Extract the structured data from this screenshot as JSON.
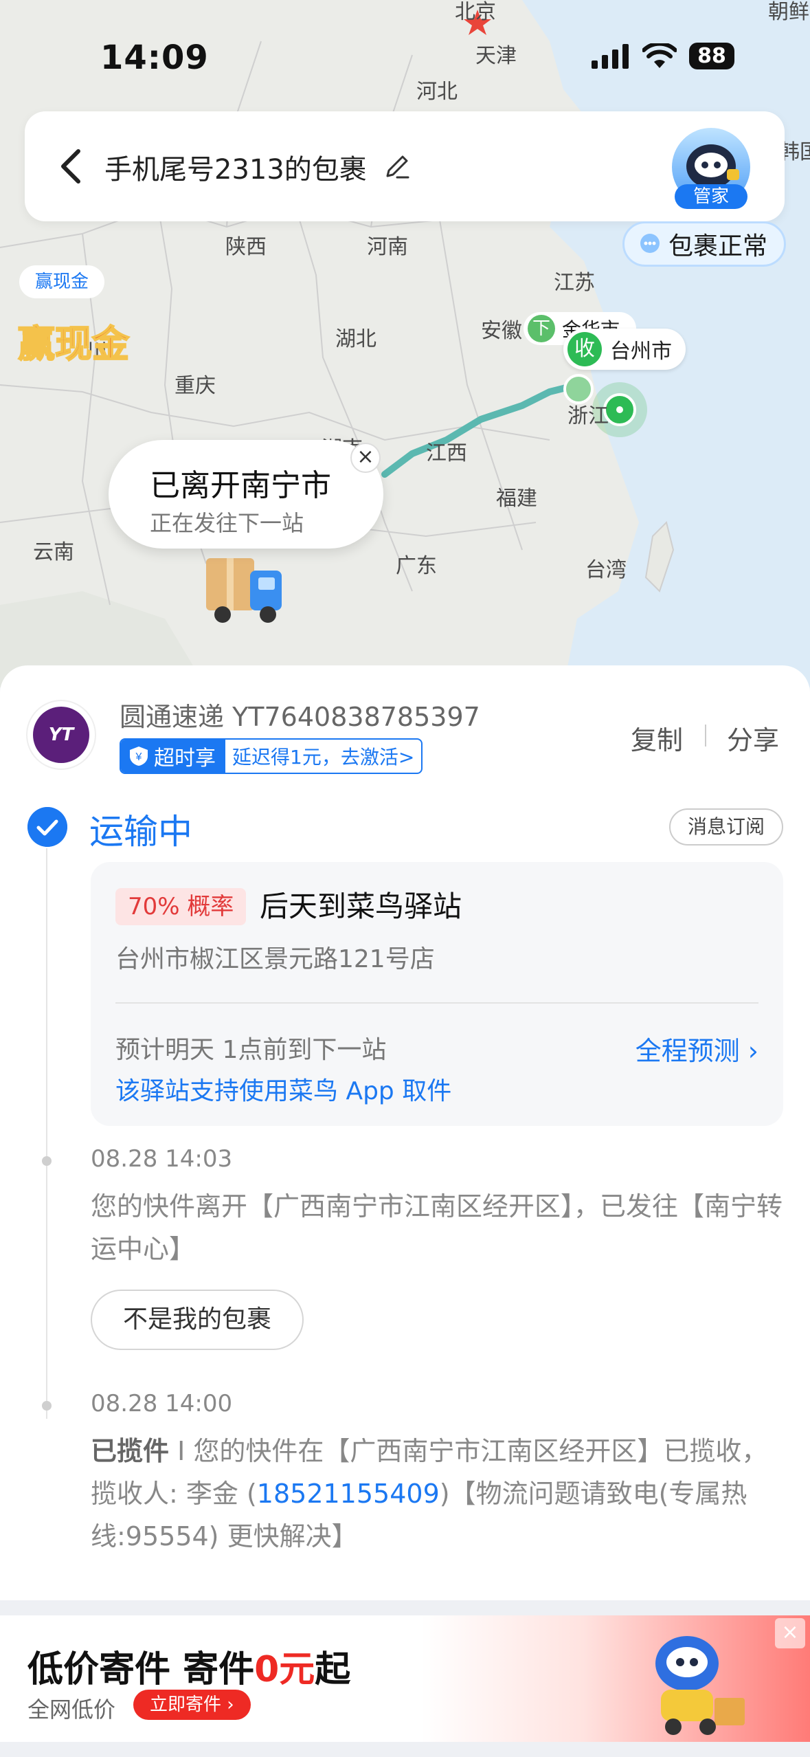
{
  "status_bar": {
    "time": "14:09",
    "battery": "88"
  },
  "map": {
    "labels": [
      "北京",
      "天津",
      "河北",
      "陕西",
      "河南",
      "江苏",
      "安徽",
      "湖北",
      "重庆",
      "江西",
      "浙江",
      "福建",
      "云南",
      "广东",
      "台湾",
      "韩国",
      "朝鲜",
      "湖南",
      "川"
    ],
    "origin_tag": {
      "letter": "下",
      "label": "金华市"
    },
    "dest_tag": {
      "letter": "收",
      "label": "台州市"
    },
    "bubble": {
      "title": "已离开南宁市",
      "subtitle": "正在发往下一站"
    },
    "close_glyph": "×"
  },
  "header": {
    "title": "手机尾号2313的包裹",
    "assistant_label": "管家",
    "status_pill": "包裹正常"
  },
  "promo": {
    "badge": "赢现金",
    "big": "赢现金"
  },
  "carrier": {
    "name_and_number": "圆通速递 YT7640838785397",
    "logo_text": "YT",
    "insurance_label": "超时享",
    "insurance_offer": "延迟得1元，去激活>",
    "copy": "复制",
    "share": "分享"
  },
  "status": {
    "title": "运输中",
    "subscribe": "消息订阅"
  },
  "eta": {
    "probability": "70% 概率",
    "arrival": "后天到菜鸟驿站",
    "address": "台州市椒江区景元路121号店",
    "next_stop": "预计明天 1点前到下一站",
    "app_pickup": "该驿站支持使用菜鸟 App 取件",
    "prediction": "全程预测 ›"
  },
  "events": [
    {
      "time": "08.28 14:03",
      "text": "您的快件离开【广西南宁市江南区经开区】，已发往【南宁转运中心】",
      "button": "不是我的包裹"
    },
    {
      "time": "08.28 14:00",
      "prefix": "已揽件",
      "text_a": " I 您的快件在【广西南宁市江南区经开区】已揽收，揽收人: 李金 (",
      "phone": "18521155409",
      "text_b": ")【物流问题请致电(专属热线:95554) 更快解决】"
    }
  ],
  "ad": {
    "title_a": "低价寄件 寄件",
    "title_red": "0元",
    "title_b": "起",
    "sub": "全网低价",
    "button": "立即寄件 ›",
    "close": "×"
  }
}
